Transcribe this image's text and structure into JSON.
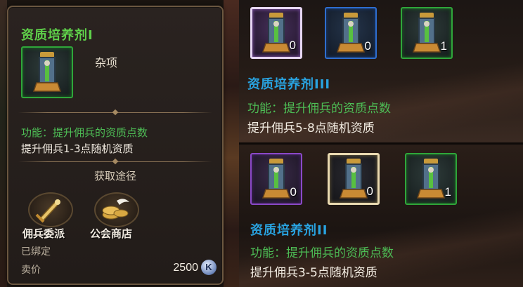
{
  "tooltip": {
    "title": "资质培养剂I",
    "item_count": "",
    "type": "杂项",
    "function": "功能：提升佣兵的资质点数",
    "description": "提升佣兵1-3点随机资质",
    "source_header": "获取途径",
    "sources": [
      {
        "label": "佣兵委派",
        "icon": "sword-icon"
      },
      {
        "label": "公会商店",
        "icon": "coins-icon"
      }
    ],
    "bound": "已绑定",
    "price_label": "卖价",
    "price": "2500",
    "currency_symbol": "K"
  },
  "panel_top": {
    "slots": [
      {
        "count": "0",
        "rarity": "purple"
      },
      {
        "count": "0",
        "rarity": "blue"
      },
      {
        "count": "1",
        "rarity": "green"
      }
    ],
    "title": "资质培养剂III",
    "function": "功能：提升佣兵的资质点数",
    "description": "提升佣兵5-8点随机资质"
  },
  "panel_bottom": {
    "slots": [
      {
        "count": "0",
        "rarity": "purple"
      },
      {
        "count": "0",
        "rarity": "gold"
      },
      {
        "count": "1",
        "rarity": "green"
      }
    ],
    "title": "资质培养剂II",
    "function": "功能：提升佣兵的资质点数",
    "description": "提升佣兵3-5点随机资质"
  },
  "colors": {
    "title_green": "#5fd04a",
    "title_blue": "#29a3e0",
    "function_green": "#4dbd55",
    "rarity_green": "#2fa63a",
    "rarity_purple": "#8b49c8",
    "rarity_blue": "#2e6ed0"
  }
}
